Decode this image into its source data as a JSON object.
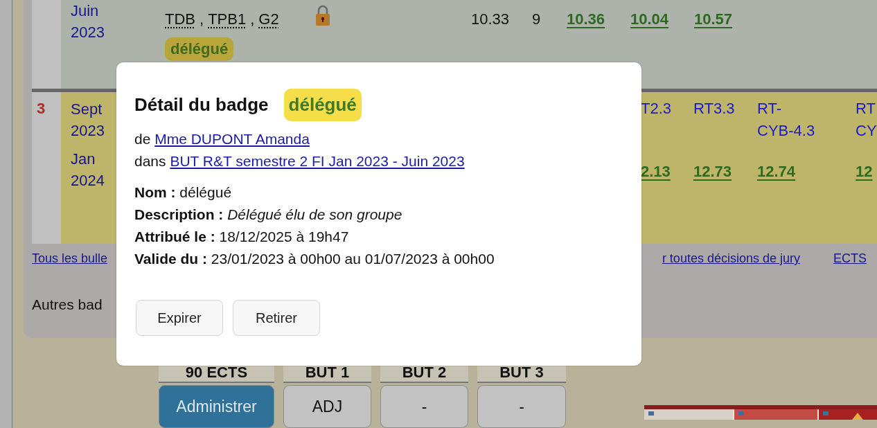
{
  "previous_row": {
    "dates": [
      "Juin 2023"
    ],
    "groups": [
      "TDB",
      "TPB1",
      "G2"
    ],
    "group_separator": ",",
    "locked": true,
    "badge": "délégué",
    "values": [
      {
        "text": "10.33",
        "kind": "plain"
      },
      {
        "text": "9",
        "kind": "plain"
      },
      {
        "text": "10.36",
        "kind": "grade"
      },
      {
        "text": "10.04",
        "kind": "grade"
      },
      {
        "text": "10.57",
        "kind": "grade"
      }
    ]
  },
  "current_row": {
    "index": "3",
    "dates": [
      "Sept 2023",
      "Jan 2024"
    ],
    "columns": [
      {
        "header": "T2.3",
        "grade": "2.13"
      },
      {
        "header": "RT3.3",
        "grade": "12.73"
      },
      {
        "header": "RT-\nCYB-4.3",
        "grade": "12.74"
      },
      {
        "header": "RT\nCY",
        "grade": "12"
      }
    ]
  },
  "links": [
    "Tous les bulle",
    "r toutes décisions de jury",
    "ECTS"
  ],
  "other_badges": "Autres bad",
  "decisions": [
    {
      "header": "90 ECTS",
      "value": "Administrer",
      "kind": "competence"
    },
    {
      "header": "BUT 1",
      "value": "ADJ",
      "kind": "year"
    },
    {
      "header": "BUT 2",
      "value": "-",
      "kind": "year"
    },
    {
      "header": "BUT 3",
      "value": "-",
      "kind": "year"
    }
  ],
  "thumbnail": {
    "kind": "picture"
  },
  "dialog": {
    "title": "Détail du badge",
    "badge": "délégué",
    "author_prefix": "de",
    "author": "Mme DUPONT Amanda",
    "context_prefix": "dans",
    "context": "BUT R&T semestre 2 FI Jan 2023 - Juin 2023",
    "fields": [
      "**Nom :** délégué",
      "**Description :** *Délégué élu de son groupe*",
      "**Attribué le :** 18/12/2025 à 19h47",
      "**Valide du :** 23/01/2023 à 00h00 au 01/07/2023 à 00h00"
    ],
    "buttons": [
      "Expirer",
      "Retirer"
    ]
  }
}
